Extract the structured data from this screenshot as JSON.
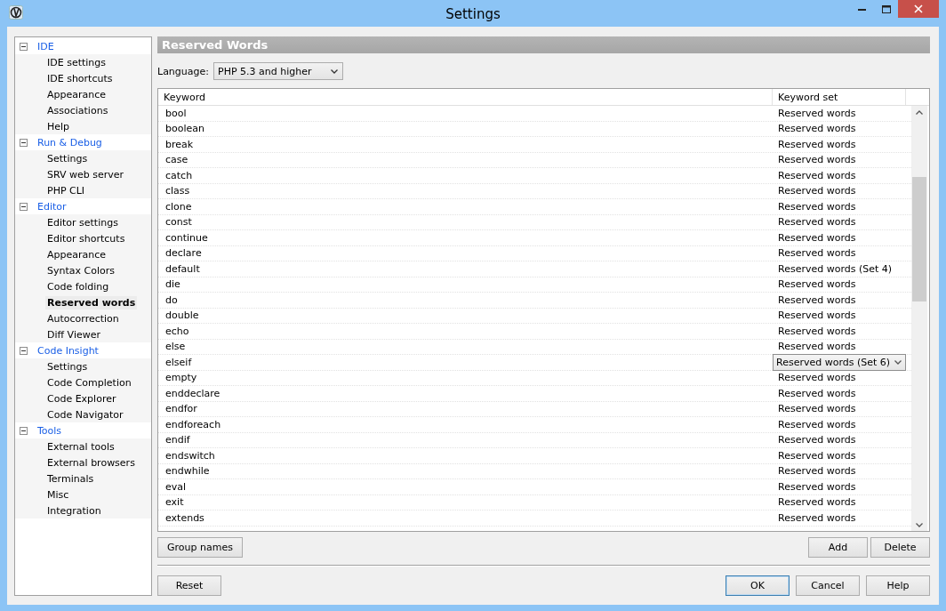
{
  "window": {
    "title": "Settings"
  },
  "tree": [
    {
      "label": "IDE",
      "expanded": true,
      "children": [
        {
          "label": "IDE settings",
          "selected": false
        },
        {
          "label": "IDE shortcuts",
          "selected": false
        },
        {
          "label": "Appearance",
          "selected": false
        },
        {
          "label": "Associations",
          "selected": false
        },
        {
          "label": "Help",
          "selected": false
        }
      ]
    },
    {
      "label": "Run & Debug",
      "expanded": true,
      "children": [
        {
          "label": "Settings",
          "selected": false
        },
        {
          "label": "SRV web server",
          "selected": false
        },
        {
          "label": "PHP CLI",
          "selected": false
        }
      ]
    },
    {
      "label": "Editor",
      "expanded": true,
      "children": [
        {
          "label": "Editor settings",
          "selected": false
        },
        {
          "label": "Editor shortcuts",
          "selected": false
        },
        {
          "label": "Appearance",
          "selected": false
        },
        {
          "label": "Syntax Colors",
          "selected": false
        },
        {
          "label": "Code folding",
          "selected": false
        },
        {
          "label": "Reserved words",
          "selected": true
        },
        {
          "label": "Autocorrection",
          "selected": false
        },
        {
          "label": "Diff Viewer",
          "selected": false
        }
      ]
    },
    {
      "label": "Code Insight",
      "expanded": true,
      "children": [
        {
          "label": "Settings",
          "selected": false
        },
        {
          "label": "Code Completion",
          "selected": false
        },
        {
          "label": "Code Explorer",
          "selected": false
        },
        {
          "label": "Code Navigator",
          "selected": false
        }
      ]
    },
    {
      "label": "Tools",
      "expanded": true,
      "children": [
        {
          "label": "External tools",
          "selected": false
        },
        {
          "label": "External browsers",
          "selected": false
        },
        {
          "label": "Terminals",
          "selected": false
        },
        {
          "label": "Misc",
          "selected": false
        },
        {
          "label": "Integration",
          "selected": false
        }
      ]
    }
  ],
  "panel": {
    "title": "Reserved Words",
    "language_label": "Language:",
    "language": "PHP 5.3 and higher"
  },
  "table": {
    "columns": [
      "Keyword",
      "Keyword set"
    ],
    "rows": [
      {
        "keyword": "bool",
        "set": "Reserved words",
        "editing": false
      },
      {
        "keyword": "boolean",
        "set": "Reserved words",
        "editing": false
      },
      {
        "keyword": "break",
        "set": "Reserved words",
        "editing": false
      },
      {
        "keyword": "case",
        "set": "Reserved words",
        "editing": false
      },
      {
        "keyword": "catch",
        "set": "Reserved words",
        "editing": false
      },
      {
        "keyword": "class",
        "set": "Reserved words",
        "editing": false
      },
      {
        "keyword": "clone",
        "set": "Reserved words",
        "editing": false
      },
      {
        "keyword": "const",
        "set": "Reserved words",
        "editing": false
      },
      {
        "keyword": "continue",
        "set": "Reserved words",
        "editing": false
      },
      {
        "keyword": "declare",
        "set": "Reserved words",
        "editing": false
      },
      {
        "keyword": "default",
        "set": "Reserved words (Set 4)",
        "editing": false
      },
      {
        "keyword": "die",
        "set": "Reserved words",
        "editing": false
      },
      {
        "keyword": "do",
        "set": "Reserved words",
        "editing": false
      },
      {
        "keyword": "double",
        "set": "Reserved words",
        "editing": false
      },
      {
        "keyword": "echo",
        "set": "Reserved words",
        "editing": false
      },
      {
        "keyword": "else",
        "set": "Reserved words",
        "editing": false
      },
      {
        "keyword": "elseif",
        "set": "Reserved words (Set 6)",
        "editing": true
      },
      {
        "keyword": "empty",
        "set": "Reserved words",
        "editing": false
      },
      {
        "keyword": "enddeclare",
        "set": "Reserved words",
        "editing": false
      },
      {
        "keyword": "endfor",
        "set": "Reserved words",
        "editing": false
      },
      {
        "keyword": "endforeach",
        "set": "Reserved words",
        "editing": false
      },
      {
        "keyword": "endif",
        "set": "Reserved words",
        "editing": false
      },
      {
        "keyword": "endswitch",
        "set": "Reserved words",
        "editing": false
      },
      {
        "keyword": "endwhile",
        "set": "Reserved words",
        "editing": false
      },
      {
        "keyword": "eval",
        "set": "Reserved words",
        "editing": false
      },
      {
        "keyword": "exit",
        "set": "Reserved words",
        "editing": false
      },
      {
        "keyword": "extends",
        "set": "Reserved words",
        "editing": false
      }
    ]
  },
  "table_buttons": {
    "left": "Group names",
    "right": [
      "Add",
      "Delete"
    ]
  },
  "footer": {
    "left": "Reset",
    "right": [
      "OK",
      "Cancel",
      "Help"
    ]
  }
}
